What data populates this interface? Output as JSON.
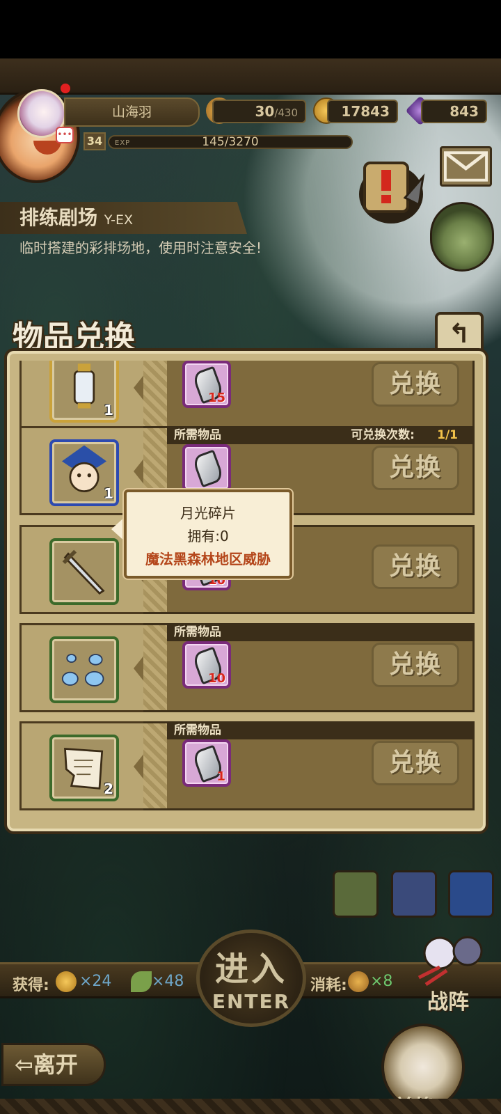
{
  "header": {
    "player_name": "山海羽",
    "level": "34",
    "exp_tag": "EXP",
    "exp": "145/3270",
    "stamina": {
      "current": "30",
      "max": "/430"
    },
    "gold": "17843",
    "gems": "843"
  },
  "stage": {
    "name": "排练剧场",
    "code": "Y-EX",
    "description": "临时搭建的彩排场地，使用时注意安全!"
  },
  "panel": {
    "title": "物品兑换",
    "back_icon": "↰",
    "rows": [
      {
        "item_icon": "lantern",
        "item_qty": "1",
        "req_icon": "moon-shard",
        "req_qty": "15",
        "button": "兑换",
        "show_head": false
      },
      {
        "item_icon": "character-card",
        "item_qty": "1",
        "req_icon": "moon-shard",
        "req_qty": "",
        "button": "兑换",
        "show_head": true,
        "head_label": "所需物品",
        "limit_label": "可兑换次数:",
        "limit_value": "1/1"
      },
      {
        "item_icon": "sword",
        "item_qty": "",
        "req_icon": "moon-shard",
        "req_qty": "10",
        "button": "兑换",
        "show_head": false
      },
      {
        "item_icon": "water-drops",
        "item_qty": "",
        "req_icon": "moon-shard",
        "req_qty": "10",
        "button": "兑换",
        "show_head": true,
        "head_label": "所需物品"
      },
      {
        "item_icon": "paper-scrap",
        "item_qty": "2",
        "req_icon": "moon-shard",
        "req_qty": "1",
        "button": "兑换",
        "show_head": true,
        "head_label": "所需物品"
      }
    ]
  },
  "tooltip": {
    "name": "月光碎片",
    "owned": "拥有:0",
    "source": "魔法黑森林地区威胁"
  },
  "rewards": {
    "gain_label": "获得:",
    "gold": "×24",
    "feather": "×48",
    "cost_label": "消耗:",
    "bread": "×8"
  },
  "buttons": {
    "enter_cn": "进入",
    "enter_en": "ENTER",
    "battle": "战阵",
    "leave": "⇦离开",
    "exchange": "兑换"
  },
  "colors": {
    "accent": "#f3c34a",
    "danger": "#d8261c",
    "tooltip_source": "#b4461a"
  }
}
